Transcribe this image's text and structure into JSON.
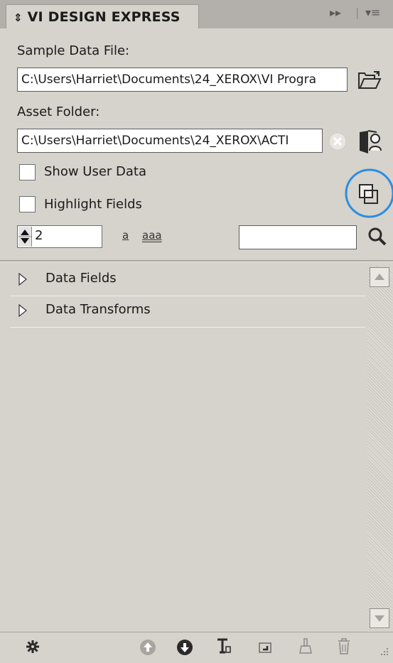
{
  "panel": {
    "title": "VI DESIGN EXPRESS",
    "collapse_glyph": "⬍",
    "menu_glyph": "▸▸ | ▾≡"
  },
  "sample_data": {
    "label": "Sample Data File:",
    "path": "C:\\Users\\Harriet\\Documents\\24_XEROX\\VI Progra",
    "browse_icon": "folder-open-icon"
  },
  "asset_folder": {
    "label": "Asset Folder:",
    "path": "C:\\Users\\Harriet\\Documents\\24_XEROX\\ACTI",
    "clear_icon": "clear-x-icon",
    "browse_icon": "folder-person-icon"
  },
  "options": {
    "show_user_data": "Show User Data",
    "highlight_fields": "Highlight Fields",
    "show_user_data_checked": false,
    "highlight_fields_checked": false
  },
  "toolbar": {
    "stepper_value": "2",
    "text_a": "a",
    "text_aaa": "aaa",
    "search_value": ""
  },
  "tree": {
    "items": [
      {
        "label": "Data Fields"
      },
      {
        "label": "Data Transforms"
      }
    ]
  },
  "colors": {
    "panel_bg": "#d6d2cc",
    "highlight_ring": "#2b8ee0"
  }
}
